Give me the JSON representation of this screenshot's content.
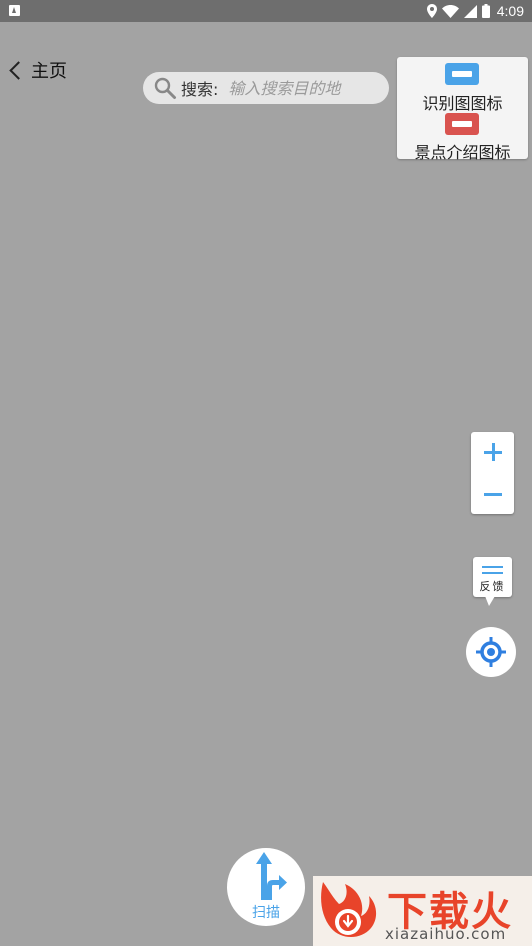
{
  "status_bar": {
    "time": "4:09",
    "icons": [
      "location-icon",
      "wifi-icon",
      "signal-icon",
      "battery-icon"
    ]
  },
  "header": {
    "back_label": "主页"
  },
  "search": {
    "label": "搜索:",
    "placeholder": "输入搜索目的地"
  },
  "legend": {
    "items": [
      {
        "label": "识别图图标",
        "color": "#4aa3e8",
        "icon": "recognition-marker-icon"
      },
      {
        "label": "景点介绍图标",
        "color": "#d9534f",
        "icon": "attraction-marker-icon"
      }
    ]
  },
  "map_controls": {
    "zoom_in": "+",
    "zoom_out": "−",
    "feedback_label": "反馈",
    "accent_color": "#4aa3e8"
  },
  "scan_button": {
    "label": "扫描"
  },
  "watermark": {
    "brand": "下载火",
    "url": "xiazaihuo.com"
  },
  "colors": {
    "map_background": "#a3a3a3",
    "status_bar": "#6e6e6e"
  }
}
